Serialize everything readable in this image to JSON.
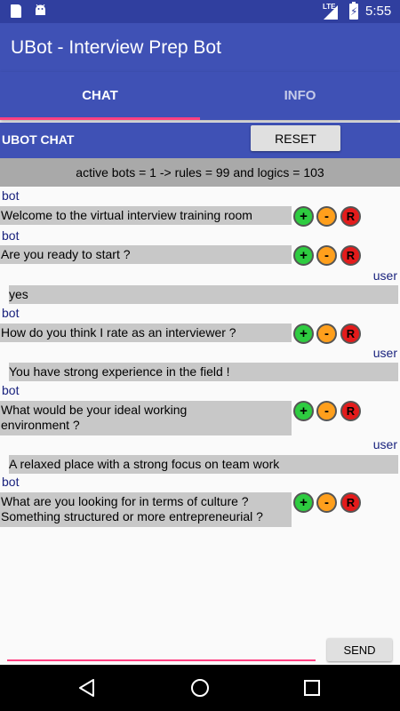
{
  "status_bar": {
    "network": "LTE",
    "time": "5:55",
    "icons": [
      "sd-card-icon",
      "android-icon",
      "signal-icon",
      "battery-charging-icon"
    ]
  },
  "app": {
    "title": "UBot - Interview Prep Bot"
  },
  "tabs": [
    {
      "label": "CHAT",
      "selected": true
    },
    {
      "label": "INFO",
      "selected": false
    }
  ],
  "chat_header": {
    "label": "UBOT CHAT",
    "reset_label": "RESET"
  },
  "info_bar": {
    "text": "active bots = 1 -> rules = 99 and logics = 103"
  },
  "messages": [
    {
      "sender": "bot",
      "lines": [
        "Welcome to the virtual interview training room"
      ]
    },
    {
      "sender": "bot",
      "lines": [
        "Are you ready to start ?"
      ]
    },
    {
      "sender": "user",
      "lines": [
        "yes"
      ]
    },
    {
      "sender": "bot",
      "lines": [
        "How do you think I rate as an interviewer ?"
      ]
    },
    {
      "sender": "user",
      "lines": [
        "You have strong experience in the field !"
      ]
    },
    {
      "sender": "bot",
      "lines": [
        "What would be your ideal working",
        "environment ?"
      ]
    },
    {
      "sender": "user",
      "lines": [
        "A relaxed place with a strong focus on team work"
      ]
    },
    {
      "sender": "bot",
      "lines": [
        "What are you looking for in terms of culture ?",
        "Something structured or more entrepreneurial ?"
      ]
    }
  ],
  "rating_buttons": {
    "plus": "+",
    "minus": "-",
    "r": "R"
  },
  "input": {
    "value": "",
    "placeholder": ""
  },
  "send_label": "SEND",
  "colors": {
    "primary": "#3f51b5",
    "primary_dark": "#303f9f",
    "accent": "#ff4081",
    "plus": "#2ecc40",
    "minus": "#ff9f1c",
    "r": "#e31b1b"
  }
}
